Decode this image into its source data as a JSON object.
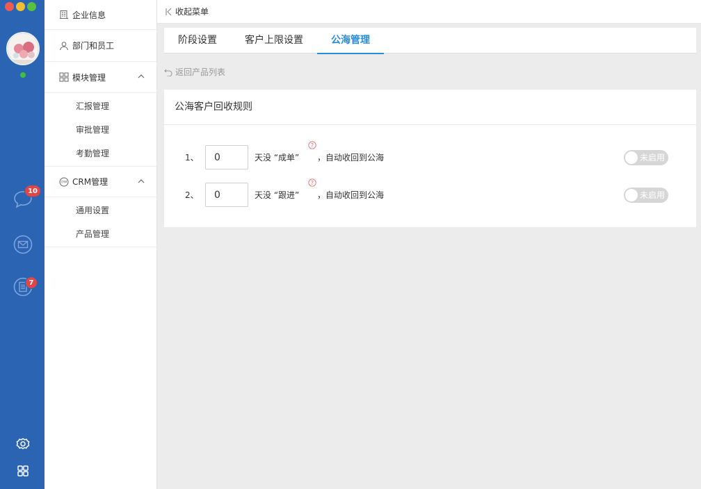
{
  "window": {
    "traffic_lights": {
      "close": "#ed5b52",
      "minimize": "#f3be2f",
      "maximize": "#58c23f"
    }
  },
  "rail": {
    "color": "#2b64b3",
    "messages_badge": "10",
    "docs_badge": "7",
    "icons": [
      "chat-icon",
      "mail-icon",
      "document-icon",
      "settings-icon",
      "apps-grid-icon"
    ]
  },
  "sidebar": {
    "company_info": "企业信息",
    "dept_staff": "部门和员工",
    "module_mgmt": "模块管理",
    "module_sub": [
      "汇报管理",
      "审批管理",
      "考勤管理"
    ],
    "crm_mgmt": "CRM管理",
    "crm_sub": [
      "通用设置",
      "产品管理"
    ]
  },
  "header": {
    "collapse_label": "收起菜单"
  },
  "tabs": [
    {
      "label": "阶段设置",
      "active": false
    },
    {
      "label": "客户上限设置",
      "active": false
    },
    {
      "label": "公海管理",
      "active": true
    }
  ],
  "back_link": "返回产品列表",
  "panel": {
    "title": "公海客户回收规则",
    "rules": [
      {
        "index": "1、",
        "days": "0",
        "text_before": "天没 “成单”",
        "text_after": "，自动收回到公海",
        "toggle_label": "未启用",
        "enabled": false
      },
      {
        "index": "2、",
        "days": "0",
        "text_before": "天没 “跟进”",
        "text_after": "，自动收回到公海",
        "toggle_label": "未启用",
        "enabled": false
      }
    ]
  },
  "colors": {
    "accent": "#2a8cd8",
    "badge": "#e04646",
    "online": "#3fbf3f"
  }
}
